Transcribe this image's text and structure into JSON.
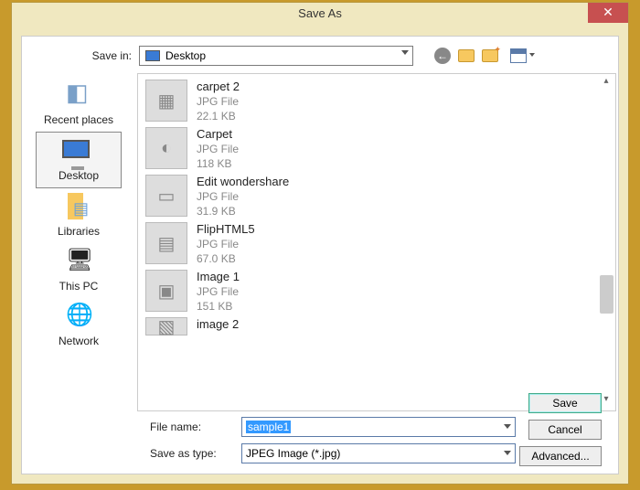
{
  "window": {
    "title": "Save As"
  },
  "toprow": {
    "savein_label": "Save in:",
    "savein_value": "Desktop"
  },
  "sidebar": {
    "items": [
      {
        "label": "Recent places"
      },
      {
        "label": "Desktop"
      },
      {
        "label": "Libraries"
      },
      {
        "label": "This PC"
      },
      {
        "label": "Network"
      }
    ]
  },
  "files": [
    {
      "name": "carpet 2",
      "type": "JPG File",
      "size": "22.1 KB"
    },
    {
      "name": "Carpet",
      "type": "JPG File",
      "size": "118 KB"
    },
    {
      "name": "Edit wondershare",
      "type": "JPG File",
      "size": "31.9 KB"
    },
    {
      "name": "FlipHTML5",
      "type": "JPG File",
      "size": "67.0 KB"
    },
    {
      "name": "Image 1",
      "type": "JPG File",
      "size": "151 KB"
    },
    {
      "name": "image 2",
      "type": "",
      "size": ""
    }
  ],
  "fields": {
    "filename_label": "File name:",
    "filename_value": "sample1",
    "savetype_label": "Save as type:",
    "savetype_value": "JPEG Image (*.jpg)"
  },
  "buttons": {
    "save": "Save",
    "cancel": "Cancel",
    "advanced": "Advanced..."
  }
}
